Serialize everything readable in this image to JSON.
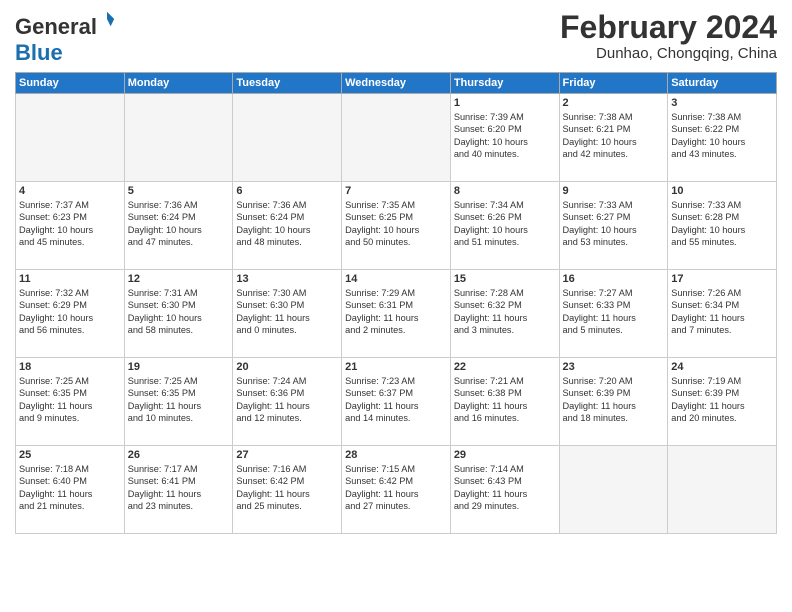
{
  "logo": {
    "general": "General",
    "blue": "Blue"
  },
  "header": {
    "month": "February 2024",
    "location": "Dunhao, Chongqing, China"
  },
  "weekdays": [
    "Sunday",
    "Monday",
    "Tuesday",
    "Wednesday",
    "Thursday",
    "Friday",
    "Saturday"
  ],
  "weeks": [
    [
      {
        "day": "",
        "text": ""
      },
      {
        "day": "",
        "text": ""
      },
      {
        "day": "",
        "text": ""
      },
      {
        "day": "",
        "text": ""
      },
      {
        "day": "1",
        "text": "Sunrise: 7:39 AM\nSunset: 6:20 PM\nDaylight: 10 hours\nand 40 minutes."
      },
      {
        "day": "2",
        "text": "Sunrise: 7:38 AM\nSunset: 6:21 PM\nDaylight: 10 hours\nand 42 minutes."
      },
      {
        "day": "3",
        "text": "Sunrise: 7:38 AM\nSunset: 6:22 PM\nDaylight: 10 hours\nand 43 minutes."
      }
    ],
    [
      {
        "day": "4",
        "text": "Sunrise: 7:37 AM\nSunset: 6:23 PM\nDaylight: 10 hours\nand 45 minutes."
      },
      {
        "day": "5",
        "text": "Sunrise: 7:36 AM\nSunset: 6:24 PM\nDaylight: 10 hours\nand 47 minutes."
      },
      {
        "day": "6",
        "text": "Sunrise: 7:36 AM\nSunset: 6:24 PM\nDaylight: 10 hours\nand 48 minutes."
      },
      {
        "day": "7",
        "text": "Sunrise: 7:35 AM\nSunset: 6:25 PM\nDaylight: 10 hours\nand 50 minutes."
      },
      {
        "day": "8",
        "text": "Sunrise: 7:34 AM\nSunset: 6:26 PM\nDaylight: 10 hours\nand 51 minutes."
      },
      {
        "day": "9",
        "text": "Sunrise: 7:33 AM\nSunset: 6:27 PM\nDaylight: 10 hours\nand 53 minutes."
      },
      {
        "day": "10",
        "text": "Sunrise: 7:33 AM\nSunset: 6:28 PM\nDaylight: 10 hours\nand 55 minutes."
      }
    ],
    [
      {
        "day": "11",
        "text": "Sunrise: 7:32 AM\nSunset: 6:29 PM\nDaylight: 10 hours\nand 56 minutes."
      },
      {
        "day": "12",
        "text": "Sunrise: 7:31 AM\nSunset: 6:30 PM\nDaylight: 10 hours\nand 58 minutes."
      },
      {
        "day": "13",
        "text": "Sunrise: 7:30 AM\nSunset: 6:30 PM\nDaylight: 11 hours\nand 0 minutes."
      },
      {
        "day": "14",
        "text": "Sunrise: 7:29 AM\nSunset: 6:31 PM\nDaylight: 11 hours\nand 2 minutes."
      },
      {
        "day": "15",
        "text": "Sunrise: 7:28 AM\nSunset: 6:32 PM\nDaylight: 11 hours\nand 3 minutes."
      },
      {
        "day": "16",
        "text": "Sunrise: 7:27 AM\nSunset: 6:33 PM\nDaylight: 11 hours\nand 5 minutes."
      },
      {
        "day": "17",
        "text": "Sunrise: 7:26 AM\nSunset: 6:34 PM\nDaylight: 11 hours\nand 7 minutes."
      }
    ],
    [
      {
        "day": "18",
        "text": "Sunrise: 7:25 AM\nSunset: 6:35 PM\nDaylight: 11 hours\nand 9 minutes."
      },
      {
        "day": "19",
        "text": "Sunrise: 7:25 AM\nSunset: 6:35 PM\nDaylight: 11 hours\nand 10 minutes."
      },
      {
        "day": "20",
        "text": "Sunrise: 7:24 AM\nSunset: 6:36 PM\nDaylight: 11 hours\nand 12 minutes."
      },
      {
        "day": "21",
        "text": "Sunrise: 7:23 AM\nSunset: 6:37 PM\nDaylight: 11 hours\nand 14 minutes."
      },
      {
        "day": "22",
        "text": "Sunrise: 7:21 AM\nSunset: 6:38 PM\nDaylight: 11 hours\nand 16 minutes."
      },
      {
        "day": "23",
        "text": "Sunrise: 7:20 AM\nSunset: 6:39 PM\nDaylight: 11 hours\nand 18 minutes."
      },
      {
        "day": "24",
        "text": "Sunrise: 7:19 AM\nSunset: 6:39 PM\nDaylight: 11 hours\nand 20 minutes."
      }
    ],
    [
      {
        "day": "25",
        "text": "Sunrise: 7:18 AM\nSunset: 6:40 PM\nDaylight: 11 hours\nand 21 minutes."
      },
      {
        "day": "26",
        "text": "Sunrise: 7:17 AM\nSunset: 6:41 PM\nDaylight: 11 hours\nand 23 minutes."
      },
      {
        "day": "27",
        "text": "Sunrise: 7:16 AM\nSunset: 6:42 PM\nDaylight: 11 hours\nand 25 minutes."
      },
      {
        "day": "28",
        "text": "Sunrise: 7:15 AM\nSunset: 6:42 PM\nDaylight: 11 hours\nand 27 minutes."
      },
      {
        "day": "29",
        "text": "Sunrise: 7:14 AM\nSunset: 6:43 PM\nDaylight: 11 hours\nand 29 minutes."
      },
      {
        "day": "",
        "text": ""
      },
      {
        "day": "",
        "text": ""
      }
    ]
  ]
}
